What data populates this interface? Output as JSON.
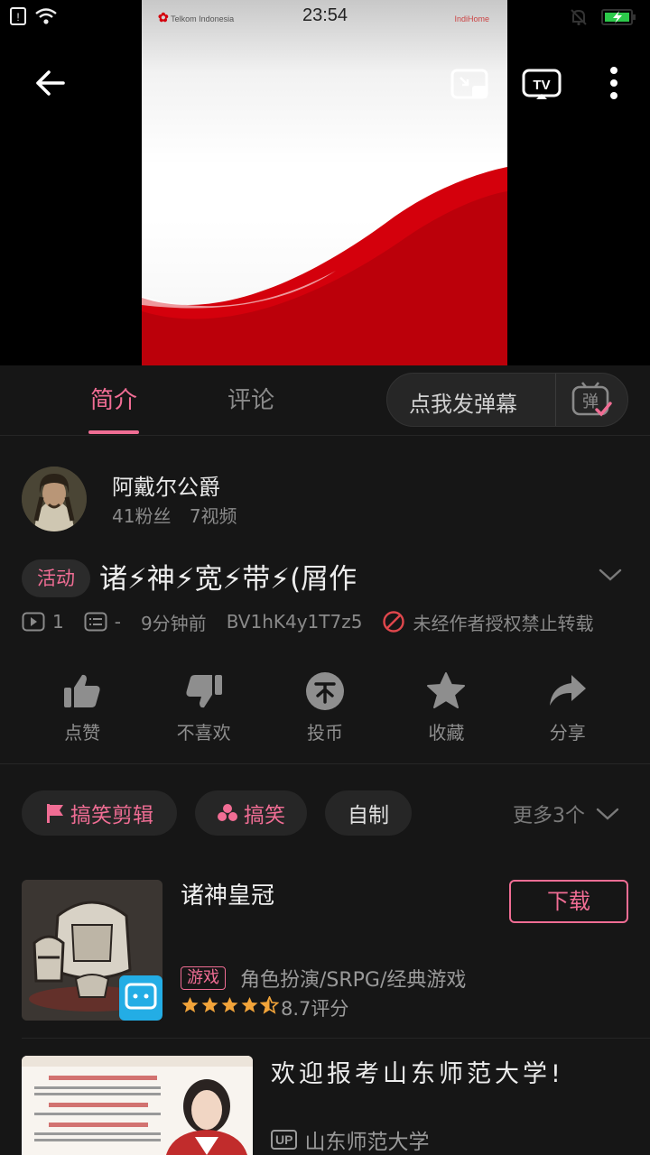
{
  "status_bar": {
    "time": "23:54",
    "icons": [
      "sim-icon",
      "wifi-icon",
      "mute-bell-icon",
      "battery-charging-icon"
    ]
  },
  "video": {
    "brand_left": "Telkom Indonesia",
    "brand_right": "IndiHome",
    "controls": [
      "back-arrow-icon",
      "pip-icon",
      "tv-cast-icon",
      "more-vertical-icon"
    ]
  },
  "tabs": {
    "intro": "简介",
    "comments": "评论",
    "danmaku_placeholder": "点我发弹幕",
    "danmaku_icon_text": "弹"
  },
  "uploader": {
    "name": "阿戴尔公爵",
    "fans": "41粉丝",
    "videos": "7视频"
  },
  "title_block": {
    "badge": "活动",
    "title": "诸⚡神⚡宽⚡带⚡(屑作",
    "plays": "1",
    "danmaku_count": "-",
    "time_ago": "9分钟前",
    "bvid": "BV1hK4y1T7z5",
    "no_repost": "未经作者授权禁止转载"
  },
  "actions": [
    {
      "label": "点赞",
      "icon": "thumbs-up-icon"
    },
    {
      "label": "不喜欢",
      "icon": "thumbs-down-icon"
    },
    {
      "label": "投币",
      "icon": "coin-icon"
    },
    {
      "label": "收藏",
      "icon": "star-icon"
    },
    {
      "label": "分享",
      "icon": "share-icon"
    }
  ],
  "tags": {
    "items": [
      {
        "label": "搞笑剪辑",
        "icon": "flag-icon"
      },
      {
        "label": "搞笑",
        "icon": "dots-cluster-icon"
      },
      {
        "label": "自制",
        "icon": ""
      }
    ],
    "more": "更多3个"
  },
  "game_card": {
    "name": "诸神皇冠",
    "download": "下载",
    "tag": "游戏",
    "genre": "角色扮演/SRPG/经典游戏",
    "rating_text": "8.7评分",
    "rating_value": 4.5
  },
  "rec_card": {
    "title": "欢迎报考山东师范大学!",
    "up_badge": "UP",
    "up_name": "山东师范大学"
  },
  "colors": {
    "accent": "#f06d94",
    "background": "#161616",
    "star": "#f2a43a"
  }
}
